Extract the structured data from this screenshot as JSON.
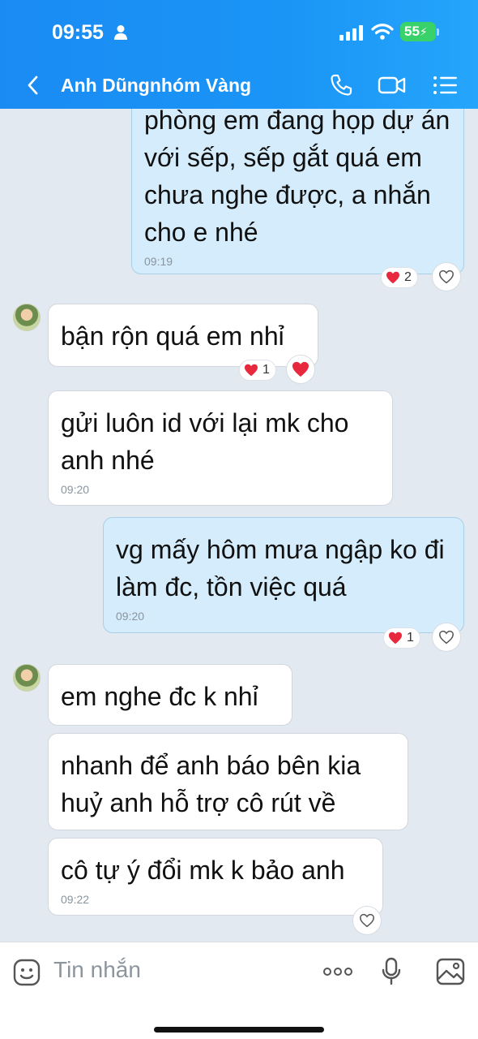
{
  "status_bar": {
    "time": "09:55",
    "battery": "55"
  },
  "header": {
    "title": "Anh Dũngnhóm Vàng"
  },
  "messages": [
    {
      "text": "phòng em đang họp dự án với sếp,  sếp gắt quá em chưa nghe được, a nhắn cho e nhé",
      "time": "09:19",
      "reaction_count": "2"
    },
    {
      "text": "bận rộn quá em nhỉ",
      "reaction_count": "1"
    },
    {
      "text": "gửi luôn id với lại mk cho anh nhé",
      "time": "09:20"
    },
    {
      "text": "vg mấy hôm mưa ngập ko đi làm đc, tồn việc quá",
      "time": "09:20",
      "reaction_count": "1"
    },
    {
      "text": "em nghe đc k nhỉ"
    },
    {
      "text": "nhanh để anh báo bên kia huỷ anh hỗ trợ cô rút về"
    },
    {
      "text": "cô tự ý đổi mk k bảo anh",
      "time": "09:22"
    }
  ],
  "composer": {
    "placeholder": "Tin nhắn"
  },
  "colors": {
    "header": "#1a8bf3",
    "outgoing_bubble": "#d4ecfb",
    "incoming_bubble": "#ffffff",
    "background": "#e2e9f1",
    "heart": "#e8283c"
  },
  "icons": [
    "back-chevron-icon",
    "phone-icon",
    "video-call-icon",
    "list-menu-icon",
    "heart-icon",
    "sticker-icon",
    "more-icon",
    "microphone-icon",
    "image-icon"
  ]
}
